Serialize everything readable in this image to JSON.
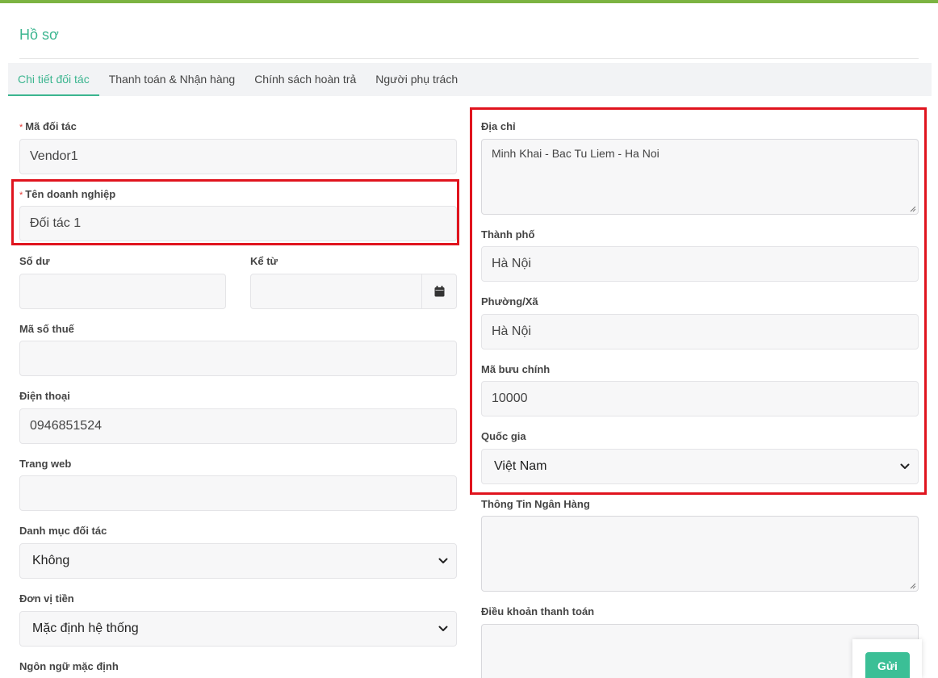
{
  "header": {
    "title": "Hồ sơ"
  },
  "tabs": [
    {
      "label": "Chi tiết đối tác",
      "active": true
    },
    {
      "label": "Thanh toán & Nhận hàng",
      "active": false
    },
    {
      "label": "Chính sách hoàn trả",
      "active": false
    },
    {
      "label": "Người phụ trách",
      "active": false
    }
  ],
  "left": {
    "vendor_code": {
      "label": "Mã đối tác",
      "required": true,
      "value": "Vendor1"
    },
    "company_name": {
      "label": "Tên doanh nghiệp",
      "required": true,
      "value": "Đối tác 1"
    },
    "balance": {
      "label": "Số dư",
      "value": ""
    },
    "since": {
      "label": "Kể từ",
      "value": ""
    },
    "tax_code": {
      "label": "Mã số thuế",
      "value": ""
    },
    "phone": {
      "label": "Điện thoại",
      "value": "0946851524"
    },
    "website": {
      "label": "Trang web",
      "value": ""
    },
    "category": {
      "label": "Danh mục đối tác",
      "value": "Không"
    },
    "currency": {
      "label": "Đơn vị tiền",
      "value": "Mặc định hệ thống"
    },
    "language": {
      "label": "Ngôn ngữ mặc định"
    }
  },
  "right": {
    "address": {
      "label": "Địa chỉ",
      "value": "Minh Khai - Bac Tu Liem - Ha Noi"
    },
    "city": {
      "label": "Thành phố",
      "value": "Hà Nội"
    },
    "ward": {
      "label": "Phường/Xã",
      "value": "Hà Nội"
    },
    "postal_code": {
      "label": "Mã bưu chính",
      "value": "10000"
    },
    "country": {
      "label": "Quốc gia",
      "value": "Việt Nam"
    },
    "bank_info": {
      "label": "Thông Tin Ngân Hàng",
      "value": ""
    },
    "payment_terms": {
      "label": "Điều khoản thanh toán",
      "value": ""
    }
  },
  "actions": {
    "send_label": "Gửi"
  },
  "colors": {
    "accent": "#3bb58f",
    "highlight": "#e0141e",
    "top_bar": "#7cb342",
    "button": "#3bbf96"
  },
  "icons": {
    "calendar": "calendar-icon",
    "select_arrow": "chevron-down-icon"
  }
}
